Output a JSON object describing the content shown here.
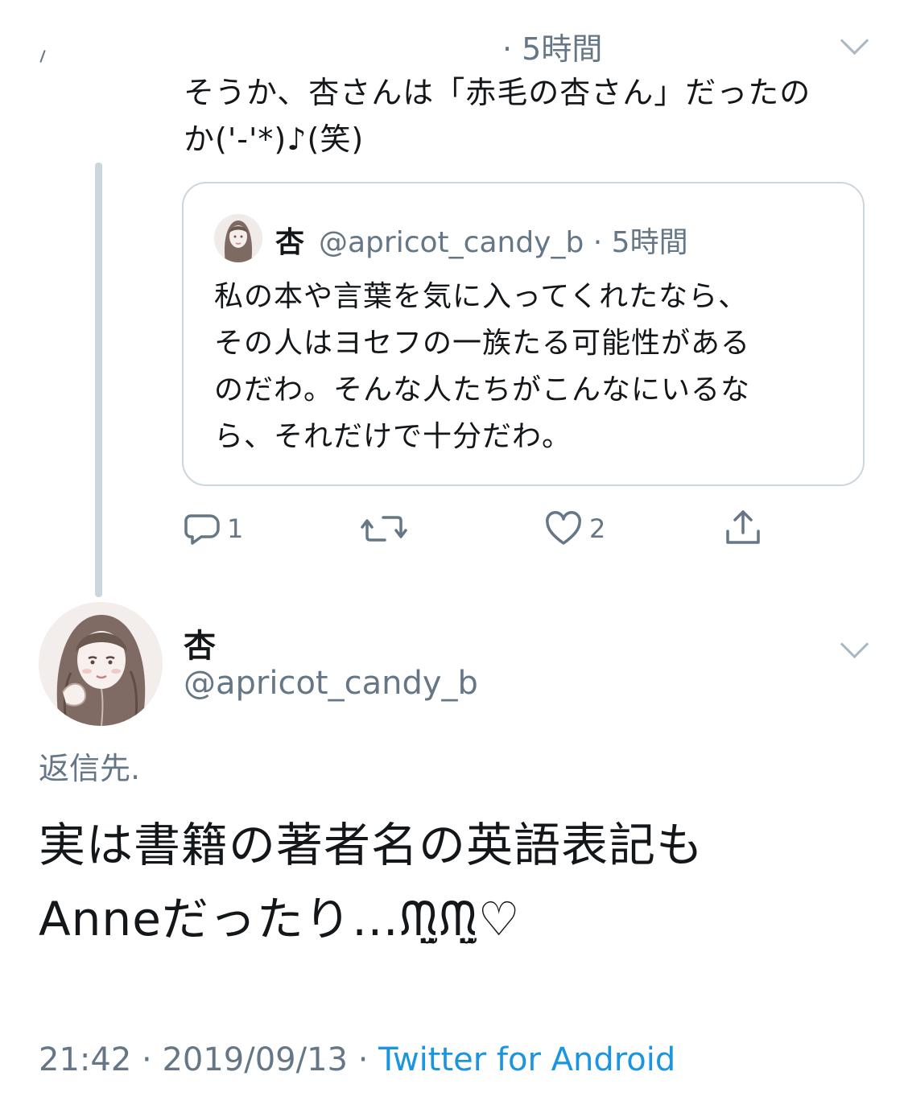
{
  "parent_tweet": {
    "time": "· 5時間",
    "text": "そうか、杏さんは「赤毛の杏さん」だったの\nか('-'*)♪(笑)"
  },
  "quoted_tweet": {
    "name": "杏",
    "handle": "@apricot_candy_b",
    "time": "5時間",
    "text": "私の本や言葉を気に入ってくれたなら、\nその人はヨセフの一族たる可能性がある\nのだわ。そんな人たちがこんなにいるな\nら、それだけで十分だわ。"
  },
  "actions": {
    "reply_icon": "reply-icon",
    "reply_count": "1",
    "retweet_icon": "retweet-icon",
    "retweet_count": "",
    "like_icon": "heart-icon",
    "like_count": "2",
    "share_icon": "share-icon"
  },
  "main_tweet": {
    "name": "杏",
    "handle": "@apricot_candy_b",
    "reply_to": "返信先.",
    "text": "実は書籍の著者名の英語表記も\nAnneだったり…ᙏ̤̫ᙏ̤̫♡",
    "time": "21:42",
    "date": "2019/09/13",
    "source": "Twitter for Android"
  },
  "colors": {
    "text": "#14171a",
    "muted": "#657786",
    "link": "#1b95e0",
    "border": "#ccd6dd",
    "icon": "#657786"
  }
}
